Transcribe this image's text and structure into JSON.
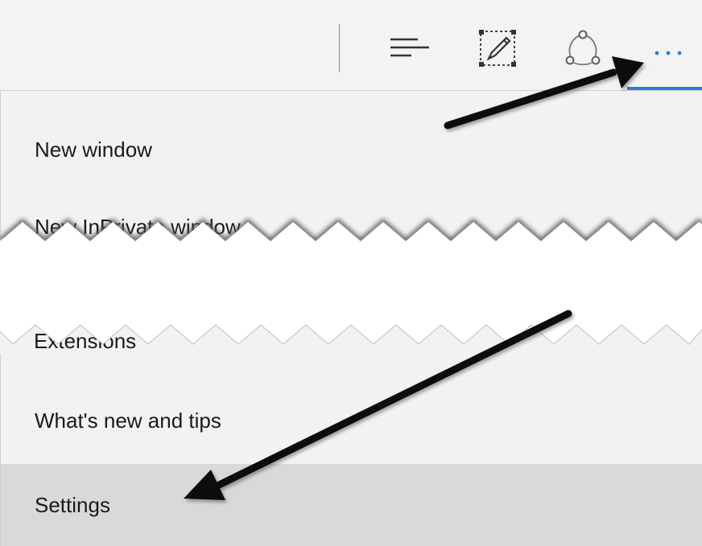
{
  "toolbar": {
    "buttons": [
      {
        "name": "reading-list-hub-button",
        "icon": "hub-icon"
      },
      {
        "name": "make-web-note-button",
        "icon": "web-note-pen-icon"
      },
      {
        "name": "share-button",
        "icon": "share-icon"
      },
      {
        "name": "more-actions-button",
        "icon": "ellipsis-icon",
        "label": "•••",
        "active": true
      }
    ],
    "accent_color": "#2b7fd4"
  },
  "menu": {
    "items_top": [
      {
        "label": "New window"
      },
      {
        "label": "New InPrivate window",
        "partially_hidden": true
      }
    ],
    "items_middle_partial": [
      {
        "label": "Extensions",
        "partially_hidden": true
      }
    ],
    "items_bottom": [
      {
        "label": "What's new and tips"
      },
      {
        "label": "Settings",
        "highlighted": true
      }
    ],
    "background_color": "#f2f2f2",
    "highlight_color": "#d9d9d9"
  },
  "annotations": [
    {
      "name": "arrow-to-more-button",
      "color": "#111111"
    },
    {
      "name": "arrow-to-settings",
      "color": "#111111"
    }
  ]
}
